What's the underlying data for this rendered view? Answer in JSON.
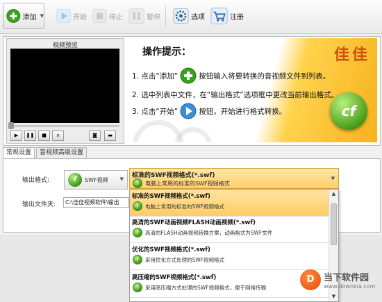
{
  "toolbar": {
    "add_label": "添加",
    "start_label": "开始",
    "stop_label": "停止",
    "pause_label": "暂停",
    "options_label": "选项",
    "register_label": "注册"
  },
  "video": {
    "title": "视频预览"
  },
  "tips": {
    "heading": "操作提示：",
    "brand": "佳佳",
    "step1_before": "1. 点击“添加”",
    "step1_after": "按钮输入将要转换的音视频文件到列表。",
    "step2": "2. 选中列表中文件，在“输出格式”选项框中更改当前输出格式。",
    "step3_before": "3. 点击“开始”",
    "step3_after": "按钮，开始进行格式转换。"
  },
  "tabs": [
    "常规设置",
    "音视频高级设置"
  ],
  "settings": {
    "output_format_label": "输出格式:",
    "output_folder_label": "输出文件夹:",
    "format_icon_label": "SWF视频",
    "output_path": "C:\\佳佳视频软件\\输出",
    "selected_title": "标准的SWF视频格式(*.swf)",
    "selected_desc": "电脑上常用的标准的SWF视频格式"
  },
  "dropdown": {
    "options": [
      {
        "title": "标准的SWF视频格式(*.swf)",
        "desc": "电脑上常用的标准的SWF视频格式"
      },
      {
        "title": "高清的SWF动画视频FLASH动画视频(*.swf)",
        "desc": "高清的FLASH动画视频转换方案，动画格式为SWF文件"
      },
      {
        "title": "优化的SWF视频格式(*.swf)",
        "desc": "采用优化方式处理的SWF视频格式"
      },
      {
        "title": "高压缩的SWF视频格式(*.swf)",
        "desc": "采用高压缩方式处理的SWF视频格式，便于网络传输"
      }
    ]
  },
  "watermark": {
    "name": "当下软件园",
    "url": "www.downxia.com"
  }
}
